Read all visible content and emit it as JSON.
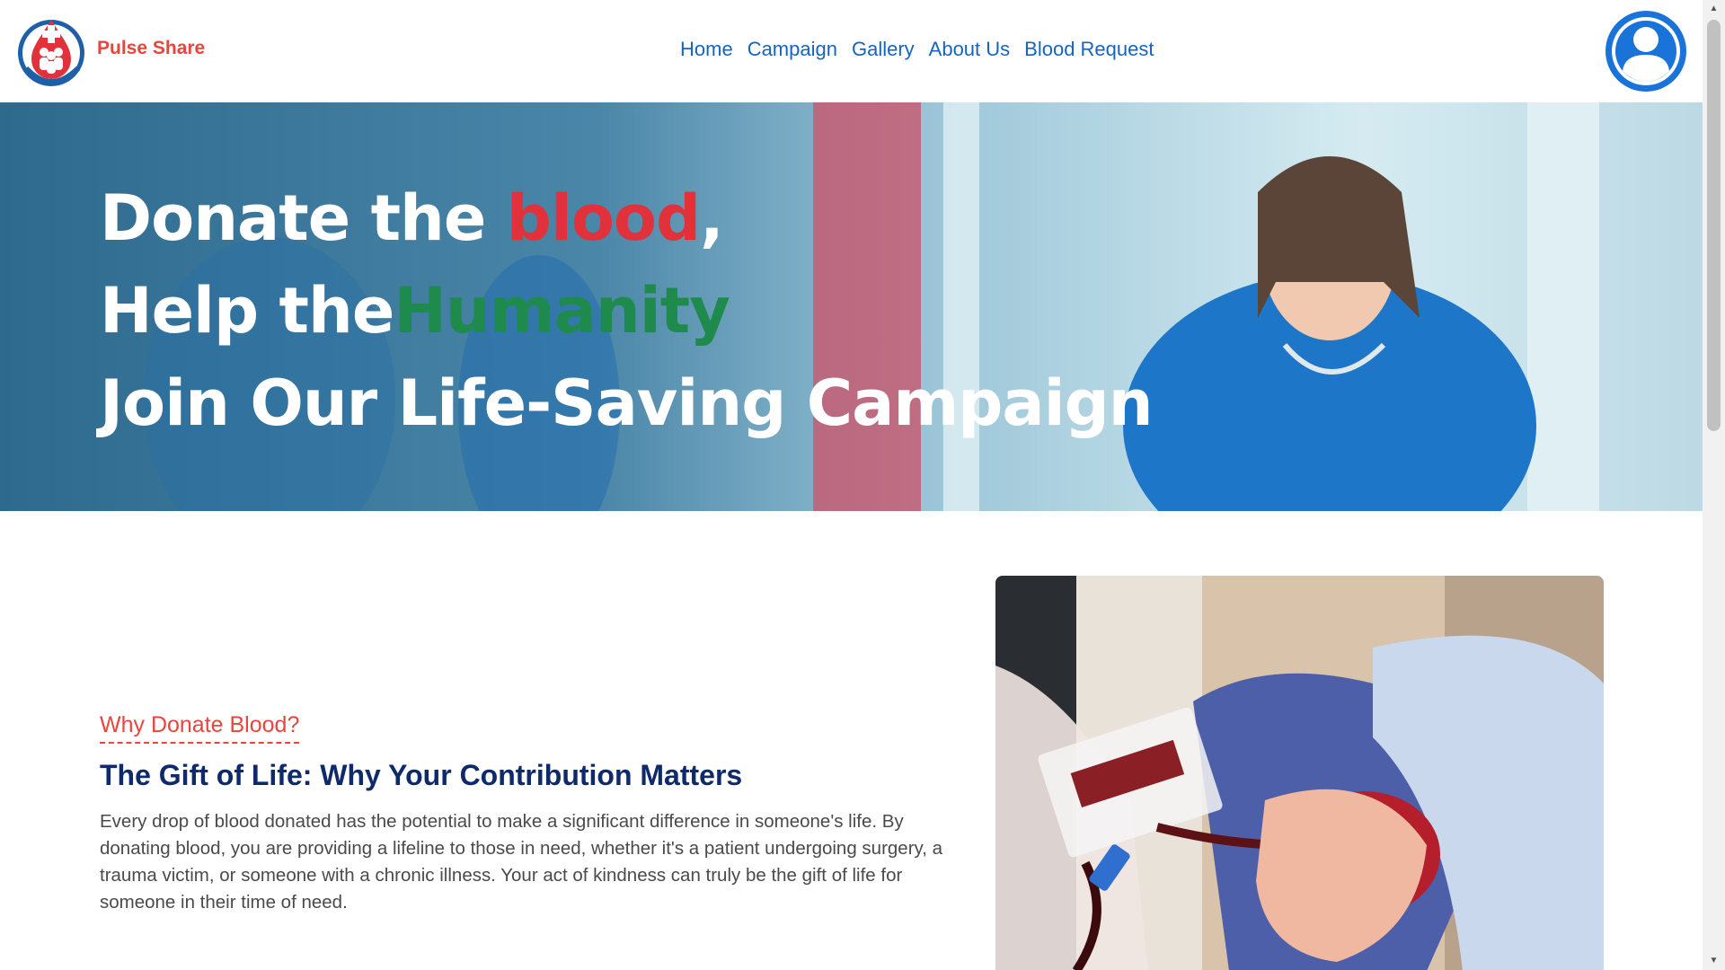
{
  "header": {
    "brand": "Pulse Share",
    "nav": [
      "Home",
      "Campaign",
      "Gallery",
      "About Us",
      "Blood Request"
    ]
  },
  "hero": {
    "line1_prefix": "Donate the ",
    "line1_accent": "blood",
    "line1_suffix": ",",
    "line2_prefix": "Help the",
    "line2_accent": "Humanity",
    "line3": "Join Our Life-Saving Campaign"
  },
  "section": {
    "kicker": "Why Donate Blood?",
    "title": "The Gift of Life: Why Your Contribution Matters",
    "body": "Every drop of blood donated has the potential to make a significant difference in someone's life. By donating blood, you are providing a lifeline to those in need, whether it's a patient undergoing surgery, a trauma victim, or someone with a chronic illness. Your act of kindness can truly be the gift of life for someone in their time of need."
  },
  "colors": {
    "brand_red": "#e8463c",
    "nav_blue": "#1565c0",
    "title_navy": "#0e2a6b",
    "accent_green": "#1e8a4c",
    "avatar_blue": "#1a73d9"
  },
  "icons": {
    "logo": "blood-donation-logo-icon",
    "avatar": "user-avatar-icon",
    "scroll_up": "chevron-up-icon",
    "scroll_down": "chevron-down-icon"
  }
}
